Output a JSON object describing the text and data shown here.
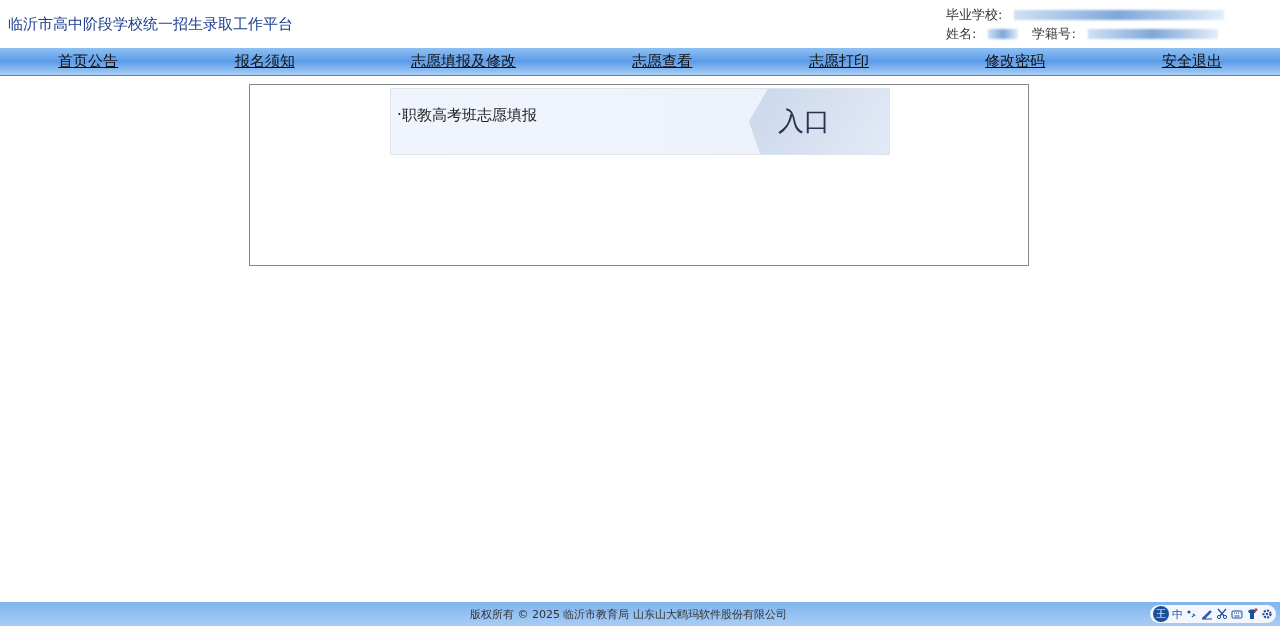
{
  "header": {
    "title": "临沂市高中阶段学校统一招生录取工作平台",
    "school_label": "毕业学校:",
    "name_label": "姓名:",
    "student_id_label": "学籍号:"
  },
  "nav": [
    {
      "label": "首页公告"
    },
    {
      "label": "报名须知"
    },
    {
      "label": "志愿填报及修改"
    },
    {
      "label": "志愿查看"
    },
    {
      "label": "志愿打印"
    },
    {
      "label": "修改密码"
    },
    {
      "label": "安全退出"
    }
  ],
  "entries": [
    {
      "label": "·职教高考班志愿填报",
      "button": "入口"
    }
  ],
  "footer": {
    "text": "版权所有 © 2025 临沂市教育局 山东山大鸥玛软件股份有限公司"
  },
  "ime": {
    "badge": "王",
    "mode": "中"
  }
}
